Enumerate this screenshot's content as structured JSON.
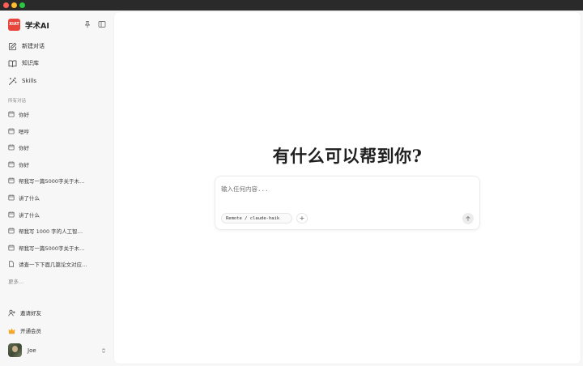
{
  "brand": {
    "logo_text": "XIAT",
    "name": "学术AI",
    "accent": "#e8453c"
  },
  "nav": {
    "new_chat": "新建对话",
    "knowledge_base": "知识库",
    "skills": "Skills"
  },
  "conversations": {
    "section_label": "所有对话",
    "items": [
      {
        "label": "你好",
        "icon": "chat-icon"
      },
      {
        "label": "嗯哼",
        "icon": "chat-icon"
      },
      {
        "label": "你好",
        "icon": "chat-icon"
      },
      {
        "label": "你好",
        "icon": "chat-icon"
      },
      {
        "label": "帮我写一篇5000字关于木…",
        "icon": "chat-icon"
      },
      {
        "label": "讲了什么",
        "icon": "chat-icon"
      },
      {
        "label": "讲了什么",
        "icon": "chat-icon"
      },
      {
        "label": "帮我写 1000 字的人工智…",
        "icon": "chat-icon"
      },
      {
        "label": "帮我写一篇5000字关于木…",
        "icon": "chat-icon"
      },
      {
        "label": "请查一下下面几篇论文对应…",
        "icon": "document-icon"
      }
    ],
    "more": "更多..."
  },
  "footer": {
    "invite": "邀请好友",
    "membership": "开通会员",
    "user_name": "Joe"
  },
  "main": {
    "headline": "有什么可以帮到你?",
    "input_placeholder": "输入任何内容...",
    "model_label": "Remote / claude-haik",
    "add_label": "+"
  }
}
